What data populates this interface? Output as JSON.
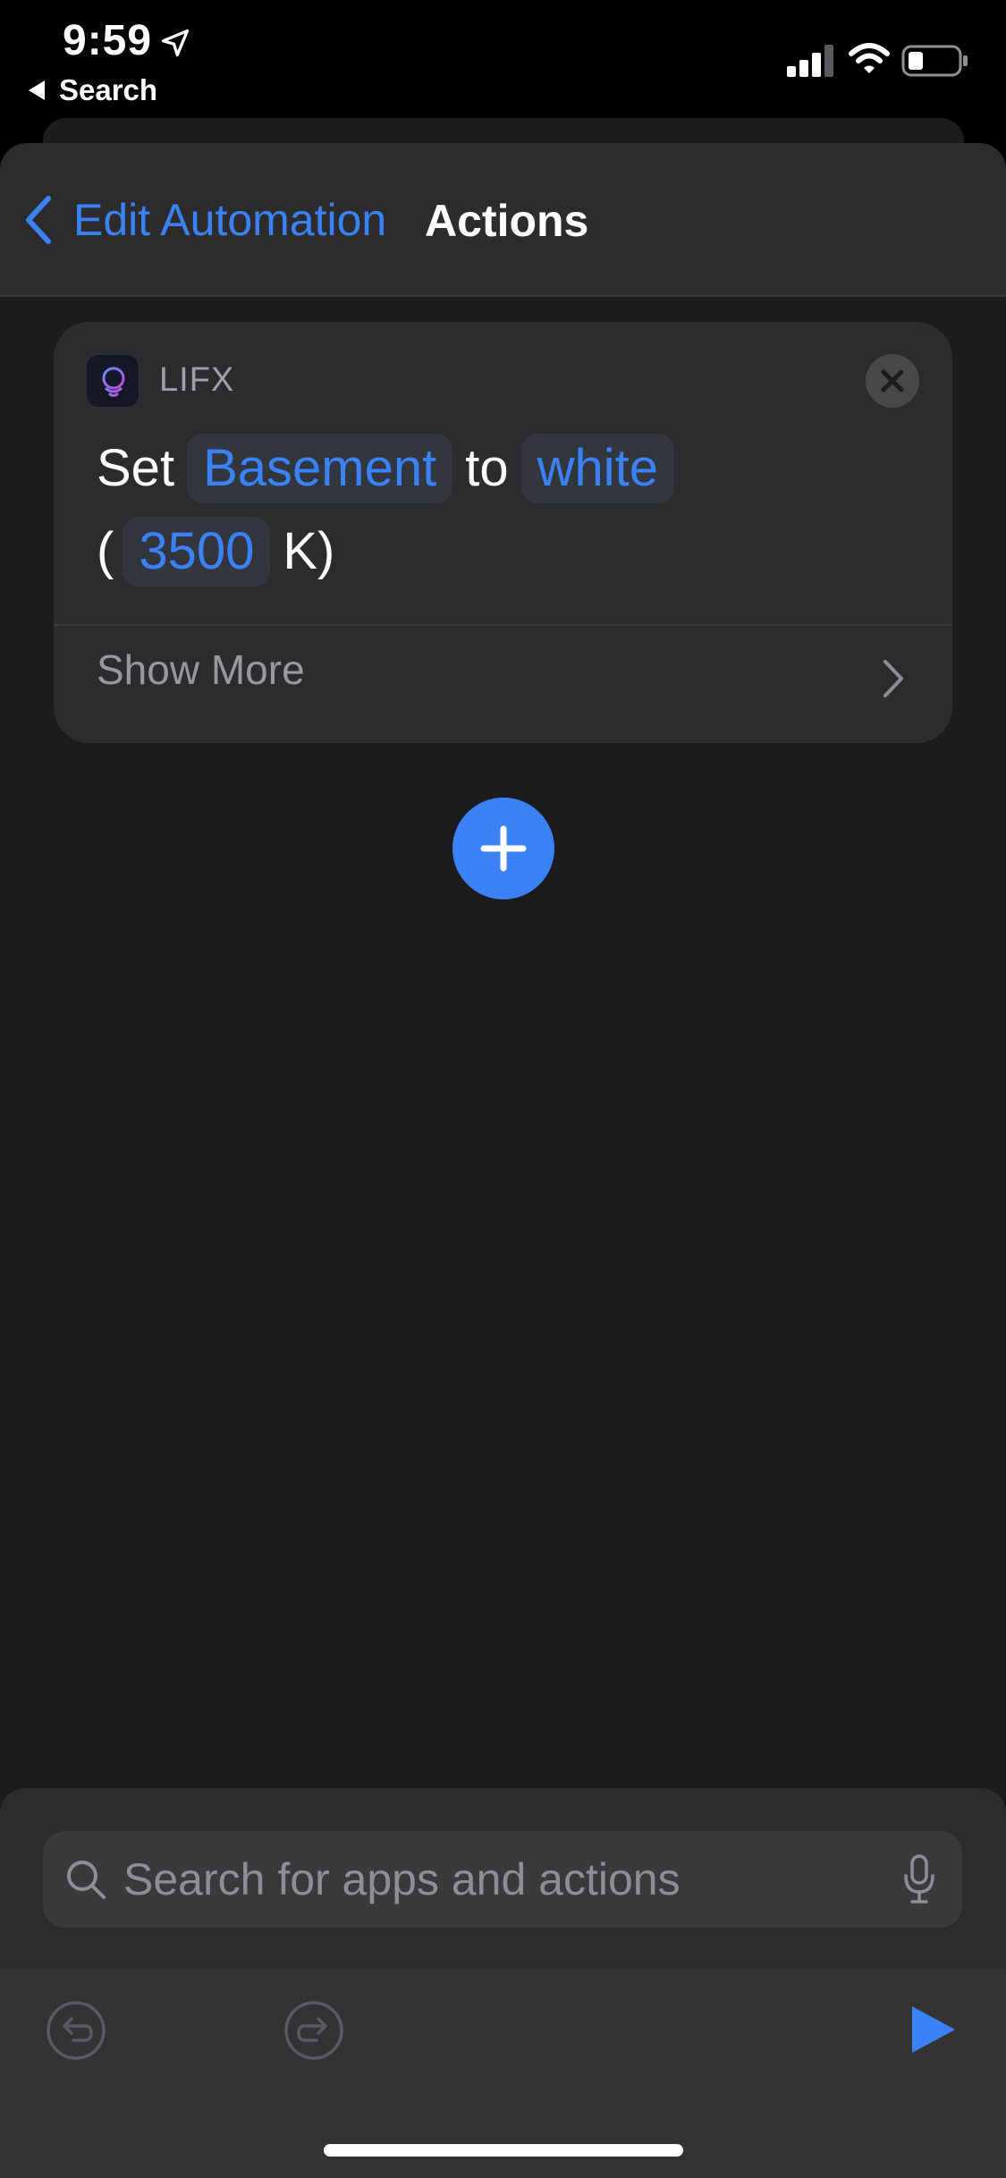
{
  "status_bar": {
    "time": "9:59",
    "back_app_label": "Search"
  },
  "nav": {
    "back_label": "Edit Automation",
    "title": "Actions"
  },
  "action_card": {
    "app_name": "LIFX",
    "verb": "Set",
    "light": "Basement",
    "connector": "to",
    "color": "white",
    "open_paren": "(",
    "kelvin": "3500",
    "unit_suffix": "K)",
    "show_more_label": "Show More"
  },
  "search": {
    "placeholder": "Search for apps and actions",
    "value": ""
  },
  "colors": {
    "accent": "#3b82f6",
    "background": "#1c1c1e",
    "card": "#2c2c2e"
  },
  "icons": [
    "location-arrow-icon",
    "signal-icon",
    "wifi-icon",
    "battery-icon",
    "chevron-left-icon",
    "lifx-app-icon",
    "close-icon",
    "chevron-right-icon",
    "plus-icon",
    "search-icon",
    "microphone-icon",
    "undo-icon",
    "redo-icon",
    "play-icon"
  ]
}
